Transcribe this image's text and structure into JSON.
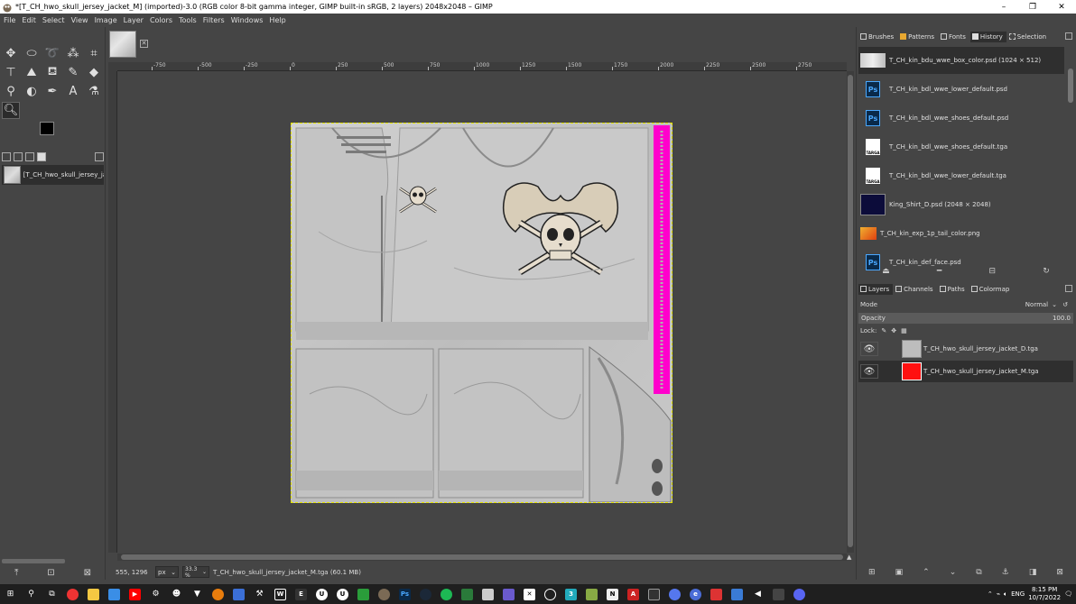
{
  "window": {
    "title": "*[T_CH_hwo_skull_jersey_jacket_M] (imported)-3.0 (RGB color 8-bit gamma integer, GIMP built-in sRGB, 2 layers) 2048x2048 – GIMP",
    "minimize": "–",
    "maximize": "❐",
    "close": "✕"
  },
  "menu": [
    "File",
    "Edit",
    "Select",
    "View",
    "Image",
    "Layer",
    "Colors",
    "Tools",
    "Filters",
    "Windows",
    "Help"
  ],
  "images_panel": {
    "item": "[T_CH_hwo_skull_jersey_jac"
  },
  "ruler": {
    "labels": [
      "-750",
      "-500",
      "-250",
      "0",
      "250",
      "500",
      "750",
      "1000",
      "1250",
      "1500",
      "1750",
      "2000",
      "2250",
      "2500",
      "2750"
    ]
  },
  "statusbar": {
    "coords": "555, 1296",
    "unit": "px",
    "zoom": "33.3 %",
    "file": "T_CH_hwo_skull_jersey_jacket_M.tga (60.1 MB)"
  },
  "top_dock": {
    "tabs": [
      "Brushes",
      "Patterns",
      "Fonts",
      "History",
      "Selection"
    ],
    "history": [
      {
        "name": "T_CH_kin_bdu_wwe_box_color.psd (1024 × 512)",
        "type": "image"
      },
      {
        "name": "T_CH_kin_bdl_wwe_lower_default.psd",
        "type": "ps"
      },
      {
        "name": "T_CH_kin_bdl_wwe_shoes_default.psd",
        "type": "ps"
      },
      {
        "name": "T_CH_kin_bdl_wwe_shoes_default.tga",
        "type": "tga"
      },
      {
        "name": "T_CH_kin_bdl_wwe_lower_default.tga",
        "type": "tga"
      },
      {
        "name": "King_Shirt_D.psd (2048 × 2048)",
        "type": "dark"
      },
      {
        "name": "T_CH_kin_exp_1p_tail_color.png",
        "type": "png"
      },
      {
        "name": "T_CH_kin_def_face.psd",
        "type": "ps"
      }
    ],
    "ps_label": "Ps",
    "tga_label": "TARGA"
  },
  "layers_dock": {
    "tabs": [
      "Layers",
      "Channels",
      "Paths",
      "Colormap"
    ],
    "mode_label": "Mode",
    "mode_value": "Normal",
    "opacity_label": "Opacity",
    "opacity_value": "100.0",
    "lock_label": "Lock:",
    "layers": [
      {
        "name": "T_CH_hwo_skull_jersey_jacket_D.tga",
        "color": "#bdbdbd"
      },
      {
        "name": "T_CH_hwo_skull_jersey_jacket_M.tga",
        "color": "#ff1010"
      }
    ]
  },
  "taskbar": {
    "time": "8:15 PM",
    "date": "10/7/2022",
    "lang": "ENG"
  },
  "colors": {
    "accent_magenta": "#ff00cc",
    "canvas_bg": "#454545",
    "selection_dash": "#e6e600"
  }
}
